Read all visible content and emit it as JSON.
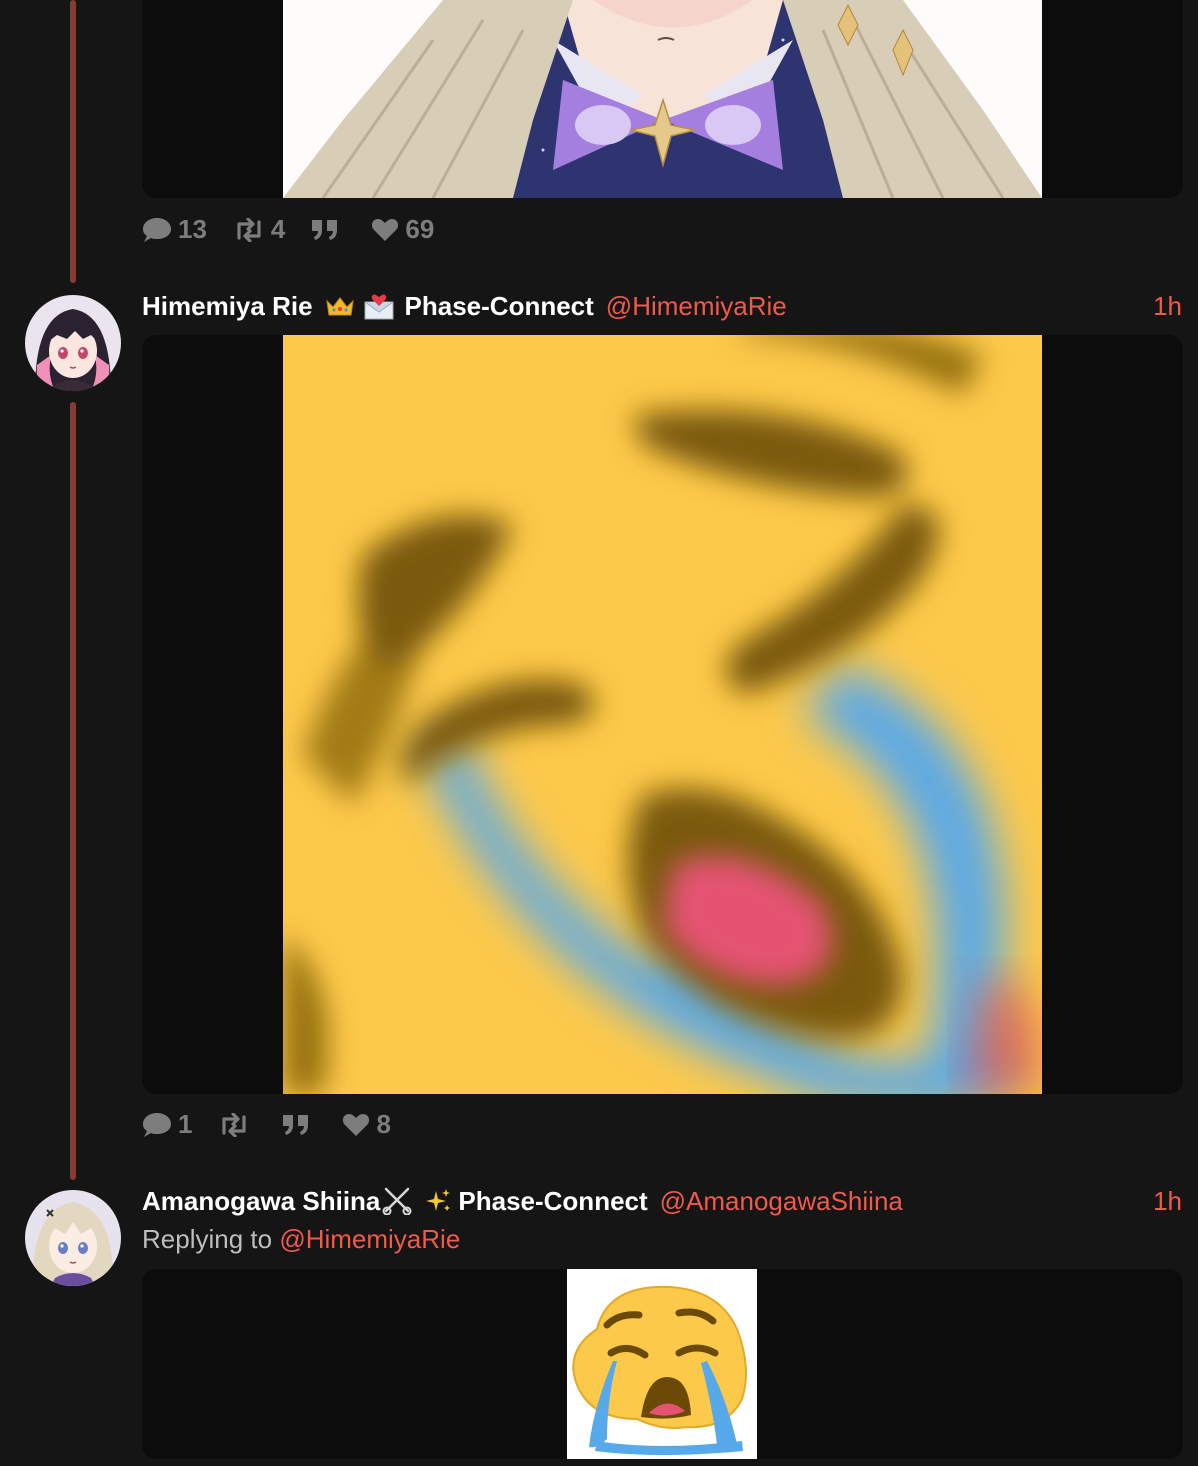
{
  "posts": [
    {
      "stats": {
        "replies": "13",
        "reposts": "4",
        "likes": "69"
      }
    },
    {
      "author_name": "Himemiya Rie",
      "author_suffix": "Phase-Connect",
      "handle": "@HimemiyaRie",
      "time": "1h",
      "emojis": [
        "crown-emoji",
        "envelope-heart-emoji"
      ],
      "stats": {
        "replies": "1",
        "reposts": "",
        "likes": "8"
      }
    },
    {
      "author_name": "Amanogawa Shiina",
      "author_suffix": "Phase-Connect",
      "handle": "@AmanogawaShiina",
      "time": "1h",
      "emojis": [
        "scissors-emoji",
        "sparkles-emoji"
      ],
      "replying_prefix": "Replying to",
      "replying_to": "@HimemiyaRie"
    }
  ],
  "colors": {
    "background": "#151515",
    "media_bg": "#0c0c0c",
    "accent": "#ef5a4b",
    "thread_line": "#8a3a34",
    "muted": "#7d7d7d",
    "emoji_yellow": "#fdc94a",
    "tear_blue": "#58a9ea"
  }
}
